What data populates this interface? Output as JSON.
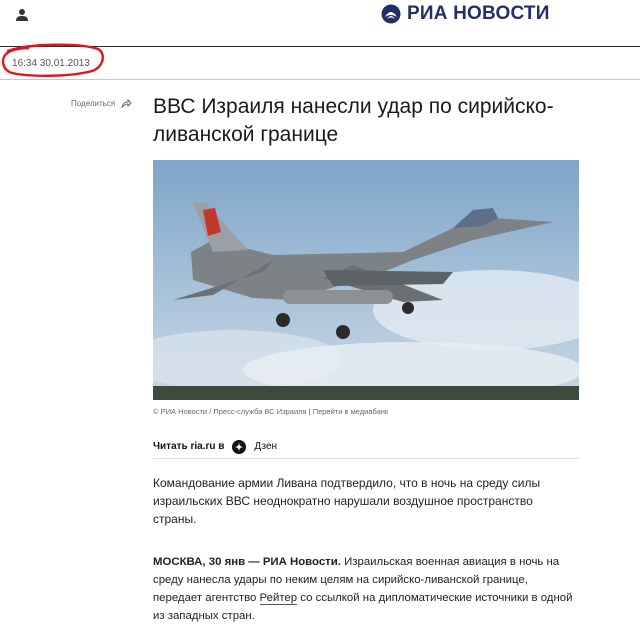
{
  "header": {
    "logo_text": "РИА НОВОСТИ",
    "brand_color": "#233067"
  },
  "article": {
    "date": "16:34 30.01.2013",
    "share_label": "Поделиться",
    "title": "ВВС Израиля нанесли удар по сирийско-ливанской границе",
    "caption": "© РИА Новости / Пресс-служба ВС Израиля | Перейти в медиабанк",
    "read_label": "Читать ria.ru в",
    "dzen_label": "Дзен",
    "lead": "Командование армии Ливана подтвердило, что в ночь на среду силы израильских ВВС неоднократно нарушали воздушное пространство страны.",
    "body": {
      "dateline": "МОСКВА, 30 янв — РИА Новости.",
      "text_1": " Израильская военная авиация в ночь на среду нанесла удары по неким целям на сирийско-ливанской границе, передает агентство ",
      "link": "Рейтер",
      "text_2": " со ссылкой на дипломатические источники в одной из западных стран."
    },
    "annotation_color": "#e0151b"
  }
}
